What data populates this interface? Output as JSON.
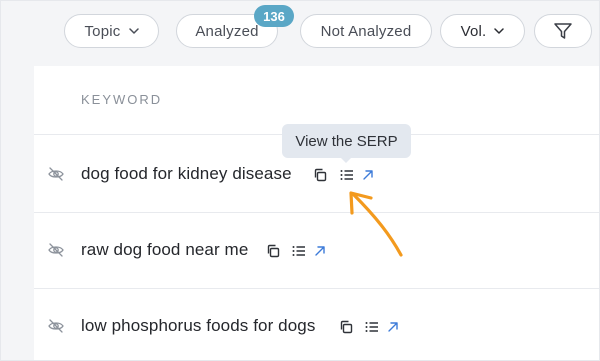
{
  "filters": {
    "topic_label": "Topic",
    "analyzed_label": "Analyzed",
    "analyzed_count": "136",
    "not_analyzed_label": "Not Analyzed",
    "vol_label": "Vol.",
    "filter_icon": "funnel-icon"
  },
  "table": {
    "column_header": "KEYWORD",
    "rows": [
      {
        "keyword": "dog food for kidney disease"
      },
      {
        "keyword": "raw dog food near me"
      },
      {
        "keyword": "low phosphorus foods for dogs"
      }
    ]
  },
  "tooltip": {
    "text": "View the SERP"
  },
  "colors": {
    "annotation_arrow": "#f39a1e",
    "badge": "#5aa7c6",
    "action_link": "#3d7bd9"
  }
}
